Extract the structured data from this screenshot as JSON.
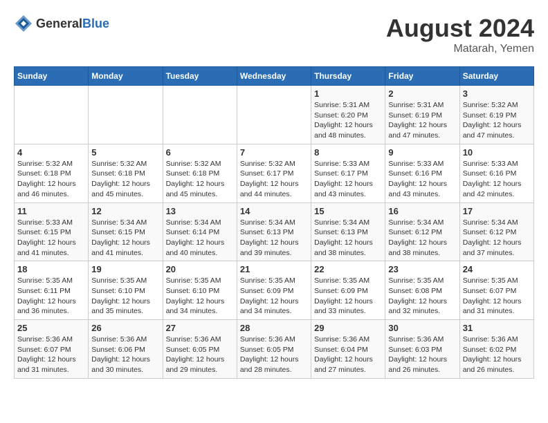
{
  "header": {
    "logo_general": "General",
    "logo_blue": "Blue",
    "title": "August 2024",
    "location": "Matarah, Yemen"
  },
  "weekdays": [
    "Sunday",
    "Monday",
    "Tuesday",
    "Wednesday",
    "Thursday",
    "Friday",
    "Saturday"
  ],
  "weeks": [
    [
      {
        "day": "",
        "sunrise": "",
        "sunset": "",
        "daylight": ""
      },
      {
        "day": "",
        "sunrise": "",
        "sunset": "",
        "daylight": ""
      },
      {
        "day": "",
        "sunrise": "",
        "sunset": "",
        "daylight": ""
      },
      {
        "day": "",
        "sunrise": "",
        "sunset": "",
        "daylight": ""
      },
      {
        "day": "1",
        "sunrise": "Sunrise: 5:31 AM",
        "sunset": "Sunset: 6:20 PM",
        "daylight": "Daylight: 12 hours and 48 minutes."
      },
      {
        "day": "2",
        "sunrise": "Sunrise: 5:31 AM",
        "sunset": "Sunset: 6:19 PM",
        "daylight": "Daylight: 12 hours and 47 minutes."
      },
      {
        "day": "3",
        "sunrise": "Sunrise: 5:32 AM",
        "sunset": "Sunset: 6:19 PM",
        "daylight": "Daylight: 12 hours and 47 minutes."
      }
    ],
    [
      {
        "day": "4",
        "sunrise": "Sunrise: 5:32 AM",
        "sunset": "Sunset: 6:18 PM",
        "daylight": "Daylight: 12 hours and 46 minutes."
      },
      {
        "day": "5",
        "sunrise": "Sunrise: 5:32 AM",
        "sunset": "Sunset: 6:18 PM",
        "daylight": "Daylight: 12 hours and 45 minutes."
      },
      {
        "day": "6",
        "sunrise": "Sunrise: 5:32 AM",
        "sunset": "Sunset: 6:18 PM",
        "daylight": "Daylight: 12 hours and 45 minutes."
      },
      {
        "day": "7",
        "sunrise": "Sunrise: 5:32 AM",
        "sunset": "Sunset: 6:17 PM",
        "daylight": "Daylight: 12 hours and 44 minutes."
      },
      {
        "day": "8",
        "sunrise": "Sunrise: 5:33 AM",
        "sunset": "Sunset: 6:17 PM",
        "daylight": "Daylight: 12 hours and 43 minutes."
      },
      {
        "day": "9",
        "sunrise": "Sunrise: 5:33 AM",
        "sunset": "Sunset: 6:16 PM",
        "daylight": "Daylight: 12 hours and 43 minutes."
      },
      {
        "day": "10",
        "sunrise": "Sunrise: 5:33 AM",
        "sunset": "Sunset: 6:16 PM",
        "daylight": "Daylight: 12 hours and 42 minutes."
      }
    ],
    [
      {
        "day": "11",
        "sunrise": "Sunrise: 5:33 AM",
        "sunset": "Sunset: 6:15 PM",
        "daylight": "Daylight: 12 hours and 41 minutes."
      },
      {
        "day": "12",
        "sunrise": "Sunrise: 5:34 AM",
        "sunset": "Sunset: 6:15 PM",
        "daylight": "Daylight: 12 hours and 41 minutes."
      },
      {
        "day": "13",
        "sunrise": "Sunrise: 5:34 AM",
        "sunset": "Sunset: 6:14 PM",
        "daylight": "Daylight: 12 hours and 40 minutes."
      },
      {
        "day": "14",
        "sunrise": "Sunrise: 5:34 AM",
        "sunset": "Sunset: 6:13 PM",
        "daylight": "Daylight: 12 hours and 39 minutes."
      },
      {
        "day": "15",
        "sunrise": "Sunrise: 5:34 AM",
        "sunset": "Sunset: 6:13 PM",
        "daylight": "Daylight: 12 hours and 38 minutes."
      },
      {
        "day": "16",
        "sunrise": "Sunrise: 5:34 AM",
        "sunset": "Sunset: 6:12 PM",
        "daylight": "Daylight: 12 hours and 38 minutes."
      },
      {
        "day": "17",
        "sunrise": "Sunrise: 5:34 AM",
        "sunset": "Sunset: 6:12 PM",
        "daylight": "Daylight: 12 hours and 37 minutes."
      }
    ],
    [
      {
        "day": "18",
        "sunrise": "Sunrise: 5:35 AM",
        "sunset": "Sunset: 6:11 PM",
        "daylight": "Daylight: 12 hours and 36 minutes."
      },
      {
        "day": "19",
        "sunrise": "Sunrise: 5:35 AM",
        "sunset": "Sunset: 6:10 PM",
        "daylight": "Daylight: 12 hours and 35 minutes."
      },
      {
        "day": "20",
        "sunrise": "Sunrise: 5:35 AM",
        "sunset": "Sunset: 6:10 PM",
        "daylight": "Daylight: 12 hours and 34 minutes."
      },
      {
        "day": "21",
        "sunrise": "Sunrise: 5:35 AM",
        "sunset": "Sunset: 6:09 PM",
        "daylight": "Daylight: 12 hours and 34 minutes."
      },
      {
        "day": "22",
        "sunrise": "Sunrise: 5:35 AM",
        "sunset": "Sunset: 6:09 PM",
        "daylight": "Daylight: 12 hours and 33 minutes."
      },
      {
        "day": "23",
        "sunrise": "Sunrise: 5:35 AM",
        "sunset": "Sunset: 6:08 PM",
        "daylight": "Daylight: 12 hours and 32 minutes."
      },
      {
        "day": "24",
        "sunrise": "Sunrise: 5:35 AM",
        "sunset": "Sunset: 6:07 PM",
        "daylight": "Daylight: 12 hours and 31 minutes."
      }
    ],
    [
      {
        "day": "25",
        "sunrise": "Sunrise: 5:36 AM",
        "sunset": "Sunset: 6:07 PM",
        "daylight": "Daylight: 12 hours and 31 minutes."
      },
      {
        "day": "26",
        "sunrise": "Sunrise: 5:36 AM",
        "sunset": "Sunset: 6:06 PM",
        "daylight": "Daylight: 12 hours and 30 minutes."
      },
      {
        "day": "27",
        "sunrise": "Sunrise: 5:36 AM",
        "sunset": "Sunset: 6:05 PM",
        "daylight": "Daylight: 12 hours and 29 minutes."
      },
      {
        "day": "28",
        "sunrise": "Sunrise: 5:36 AM",
        "sunset": "Sunset: 6:05 PM",
        "daylight": "Daylight: 12 hours and 28 minutes."
      },
      {
        "day": "29",
        "sunrise": "Sunrise: 5:36 AM",
        "sunset": "Sunset: 6:04 PM",
        "daylight": "Daylight: 12 hours and 27 minutes."
      },
      {
        "day": "30",
        "sunrise": "Sunrise: 5:36 AM",
        "sunset": "Sunset: 6:03 PM",
        "daylight": "Daylight: 12 hours and 26 minutes."
      },
      {
        "day": "31",
        "sunrise": "Sunrise: 5:36 AM",
        "sunset": "Sunset: 6:02 PM",
        "daylight": "Daylight: 12 hours and 26 minutes."
      }
    ]
  ]
}
